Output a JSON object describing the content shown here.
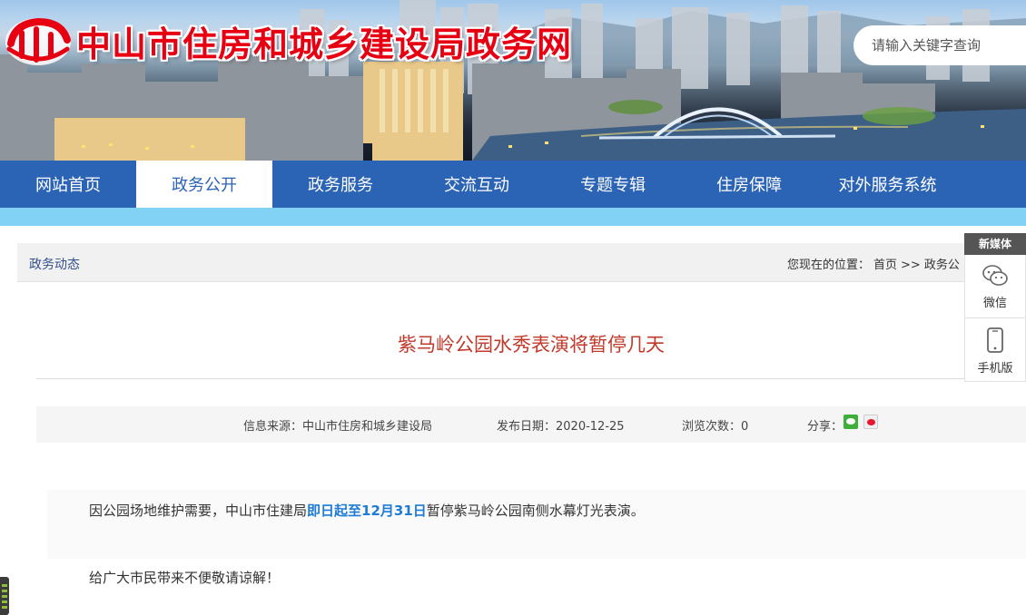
{
  "header": {
    "site_title": "中山市住房和城乡建设局政务网",
    "search_placeholder": "请输入关键字查询",
    "brand_color": "#e60012"
  },
  "nav": {
    "items": [
      {
        "label": "网站首页",
        "active": false
      },
      {
        "label": "政务公开",
        "active": true
      },
      {
        "label": "政务服务",
        "active": false
      },
      {
        "label": "交流互动",
        "active": false
      },
      {
        "label": "专题专辑",
        "active": false
      },
      {
        "label": "住房保障",
        "active": false
      },
      {
        "label": "对外服务系统",
        "active": false
      }
    ],
    "bg_color": "#2b63b5",
    "strip_color": "#82d2f6"
  },
  "breadcrumb": {
    "section": "政务动态",
    "location_label": "您现在的位置：",
    "home": "首页",
    "separator": ">>",
    "current": "政务公"
  },
  "article": {
    "title": "紫马岭公园水秀表演将暂停几天",
    "source_label": "信息来源：中山市住房和城乡建设局",
    "date_label": "发布日期：2020-12-25",
    "views_label": "浏览次数：0",
    "share_label": "分享：",
    "para1_before": "因公园场地维护需要，中山市住建局",
    "para1_highlight": "即日起至12月31日",
    "para1_after": "暂停紫马岭公园南侧水幕灯光表演。",
    "para2": "给广大市民带来不便敬请谅解！",
    "title_color": "#c0392b",
    "highlight_color": "#1e7cd4"
  },
  "side_panel": {
    "header": "新媒体",
    "items": [
      {
        "label": "微信",
        "icon": "wechat-icon"
      },
      {
        "label": "手机版",
        "icon": "mobile-phone-icon"
      }
    ]
  },
  "share_icons": [
    "wechat-share-icon",
    "weibo-share-icon"
  ]
}
